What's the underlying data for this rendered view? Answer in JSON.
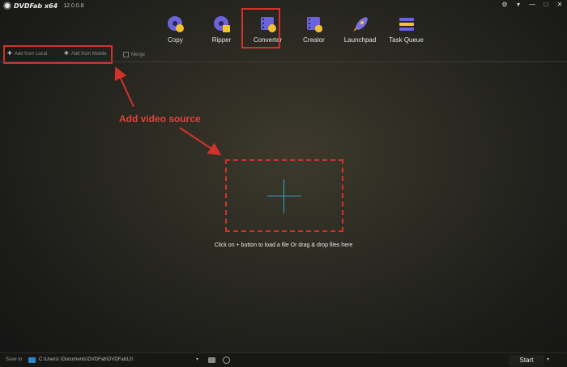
{
  "app": {
    "name": "DVDFab x64",
    "version": "12.0.0.8"
  },
  "window_controls": {
    "icons": [
      "gear-icon",
      "menu-icon",
      "minimize-icon",
      "maximize-icon",
      "close-icon"
    ],
    "glyphs": [
      "⚙",
      "▾",
      "—",
      "□",
      "✕"
    ]
  },
  "modules": [
    {
      "label": "Copy",
      "icon": "disc-copy-icon"
    },
    {
      "label": "Ripper",
      "icon": "disc-ripper-icon"
    },
    {
      "label": "Converter",
      "icon": "film-converter-icon",
      "active": true
    },
    {
      "label": "Creator",
      "icon": "film-creator-icon"
    },
    {
      "label": "Launchpad",
      "icon": "rocket-icon"
    },
    {
      "label": "Task Queue",
      "icon": "queue-list-icon"
    }
  ],
  "toolbar": {
    "add_local": "Add from Local",
    "add_mobile": "Add from Mobile",
    "merge": "Merge"
  },
  "annotation": {
    "text": "Add video source"
  },
  "drop_zone": {
    "hint": "Click on + button to load a file Or drag & drop files here"
  },
  "bottom": {
    "save_to_label": "Save to",
    "path": "C:\\Users\\          \\Documents\\DVDFab\\DVDFab12\\",
    "start_label": "Start"
  },
  "colors": {
    "annotation_red": "#d2322b",
    "accent_blue": "#33a3d0"
  }
}
